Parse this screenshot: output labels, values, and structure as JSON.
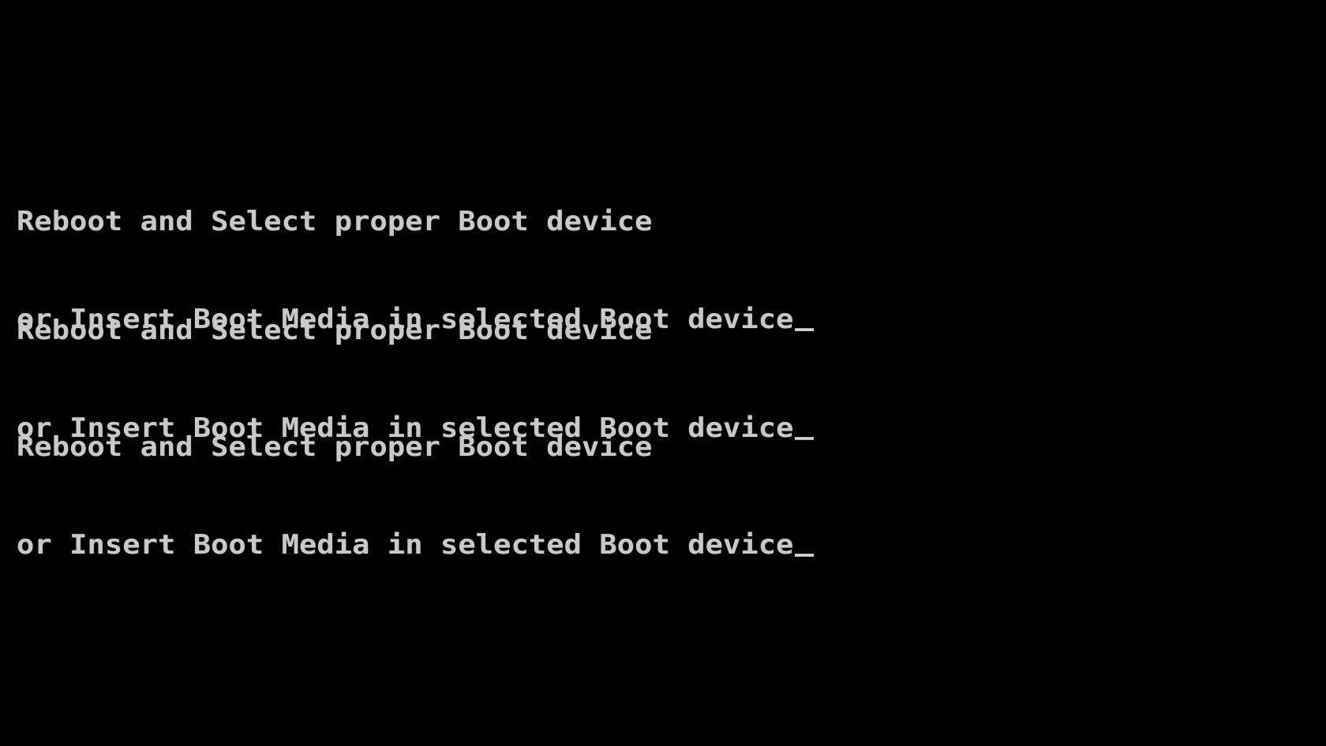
{
  "screen": {
    "background_color": "#000000",
    "text_color": "#c9c9c9",
    "messages": [
      {
        "line1": "Reboot and Select proper Boot device",
        "line2": "or Insert Boot Media in selected Boot device"
      },
      {
        "line1": "Reboot and Select proper Boot device",
        "line2": "or Insert Boot Media in selected Boot device"
      },
      {
        "line1": "Reboot and Select proper Boot device",
        "line2": "or Insert Boot Media in selected Boot device"
      }
    ],
    "cursor_glyph": "_"
  }
}
